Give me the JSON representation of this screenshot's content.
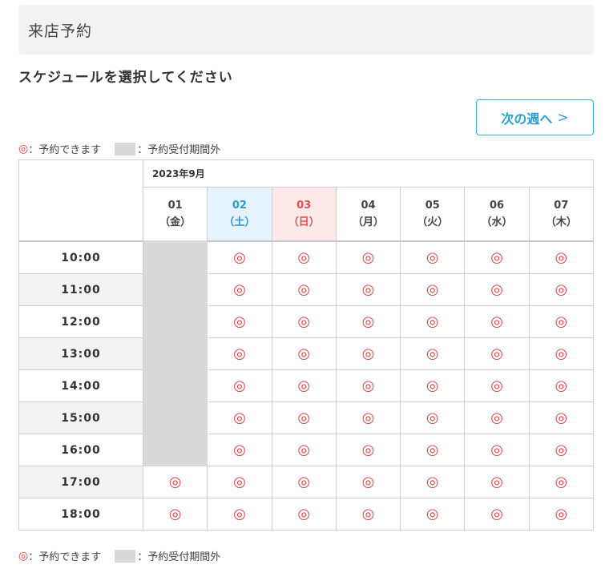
{
  "header": {
    "title": "来店予約"
  },
  "subtitle": "スケジュールを選択してください",
  "next_week": {
    "label": "次の週へ",
    "chevron": ">"
  },
  "legend": {
    "available_mark": "◎",
    "available_text": "：予約できます",
    "closed_text": "：予約受付期間外",
    "closed_color": "#d9d9d9"
  },
  "month": "2023年9月",
  "days": [
    {
      "date": "01",
      "weekday": "（金）",
      "kind": "weekday"
    },
    {
      "date": "02",
      "weekday": "（土）",
      "kind": "sat"
    },
    {
      "date": "03",
      "weekday": "（日）",
      "kind": "sun"
    },
    {
      "date": "04",
      "weekday": "（月）",
      "kind": "weekday"
    },
    {
      "date": "05",
      "weekday": "（火）",
      "kind": "weekday"
    },
    {
      "date": "06",
      "weekday": "（水）",
      "kind": "weekday"
    },
    {
      "date": "07",
      "weekday": "（木）",
      "kind": "weekday"
    }
  ],
  "slots": [
    {
      "time": "10:00",
      "cells": [
        "closed",
        "◎",
        "◎",
        "◎",
        "◎",
        "◎",
        "◎"
      ]
    },
    {
      "time": "11:00",
      "cells": [
        "closed",
        "◎",
        "◎",
        "◎",
        "◎",
        "◎",
        "◎"
      ]
    },
    {
      "time": "12:00",
      "cells": [
        "closed",
        "◎",
        "◎",
        "◎",
        "◎",
        "◎",
        "◎"
      ]
    },
    {
      "time": "13:00",
      "cells": [
        "closed",
        "◎",
        "◎",
        "◎",
        "◎",
        "◎",
        "◎"
      ]
    },
    {
      "time": "14:00",
      "cells": [
        "closed",
        "◎",
        "◎",
        "◎",
        "◎",
        "◎",
        "◎"
      ]
    },
    {
      "time": "15:00",
      "cells": [
        "closed",
        "◎",
        "◎",
        "◎",
        "◎",
        "◎",
        "◎"
      ]
    },
    {
      "time": "16:00",
      "cells": [
        "closed",
        "◎",
        "◎",
        "◎",
        "◎",
        "◎",
        "◎"
      ]
    },
    {
      "time": "17:00",
      "cells": [
        "◎",
        "◎",
        "◎",
        "◎",
        "◎",
        "◎",
        "◎"
      ]
    },
    {
      "time": "18:00",
      "cells": [
        "◎",
        "◎",
        "◎",
        "◎",
        "◎",
        "◎",
        "◎"
      ]
    }
  ],
  "colors": {
    "accent": "#2b9fd0",
    "available": "#e04545",
    "saturday_bg": "#e6f2fc",
    "sunday_bg": "#fde9e9"
  }
}
